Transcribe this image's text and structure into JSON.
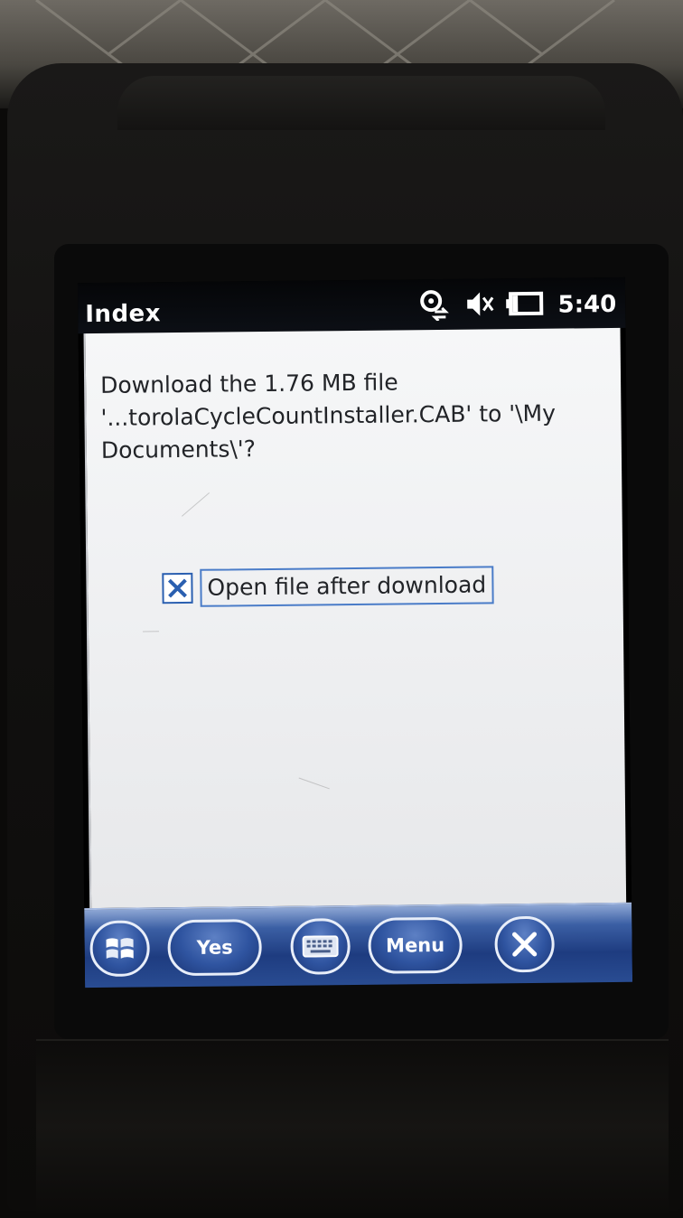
{
  "window": {
    "title": "Index",
    "clock": "5:40"
  },
  "status_icons": [
    "connectivity-icon",
    "speaker-muted-icon",
    "battery-icon"
  ],
  "dialog": {
    "message": "Download the 1.76 MB file\n'...torolaCycleCountInstaller.CAB' to '\\My\nDocuments\\'?",
    "checkbox": {
      "label": "Open file after download",
      "checked": true
    }
  },
  "softkeys": {
    "start_icon": "windows-flag-icon",
    "yes_label": "Yes",
    "keyboard_icon": "keyboard-icon",
    "menu_label": "Menu",
    "close_icon": "close-icon"
  },
  "colors": {
    "softbar": "#2a4d93",
    "checkbox_border": "#2a5fb0",
    "content_bg": "#f3f4f5"
  }
}
